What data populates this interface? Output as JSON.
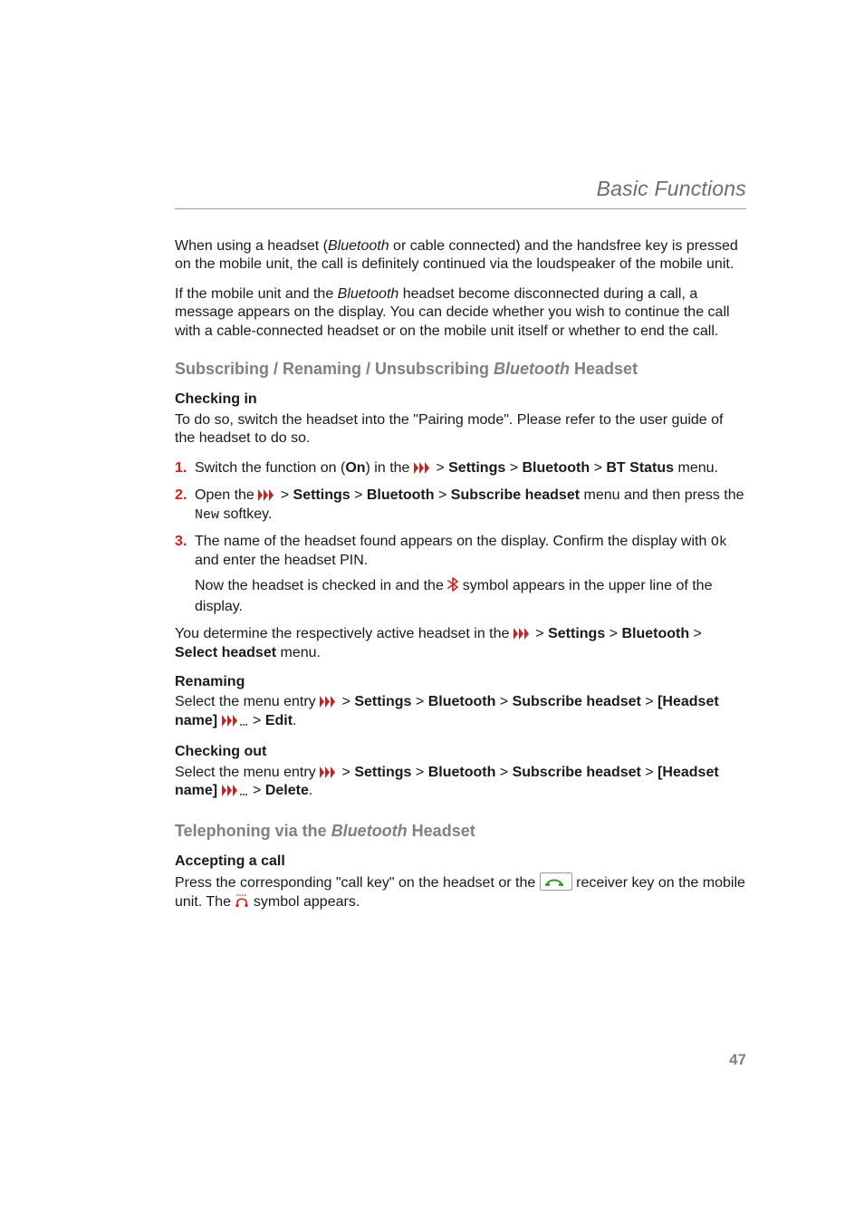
{
  "header": {
    "title": "Basic Functions"
  },
  "p1": {
    "a": "When using a headset (",
    "b": "Bluetooth",
    "c": " or cable connected) and the handsfree key is pressed on the mobile unit, the call is definitely continued via the loudspeaker of the mobile unit."
  },
  "p2": {
    "a": "If the mobile unit and the ",
    "b": "Bluetooth",
    "c": " headset become disconnected during a call, a message appears on the display. You can decide whether you wish to continue the call with a cable-connected headset or on the mobile unit itself or whether to end the call."
  },
  "h1": {
    "a": "Subscribing / Renaming / Unsubscribing ",
    "b": "Bluetooth",
    "c": " Headset"
  },
  "checkin": {
    "head": "Checking in",
    "intro": "To do so, switch the headset into the \"Pairing mode\". Please refer to the user guide of the headset to do so.",
    "s1": {
      "num": "1.",
      "a": "Switch the function on (",
      "b": "On",
      "c": ") in the ",
      "d": " > ",
      "e": "Settings",
      "f": " > ",
      "g": "Bluetooth",
      "h": " > ",
      "i": "BT Status",
      "j": " menu."
    },
    "s2": {
      "num": "2.",
      "a": "Open the ",
      "b": " > ",
      "c": "Settings",
      "d": " > ",
      "e": "Bluetooth",
      "f": " > ",
      "g": "Subscribe headset",
      "h": " menu and then press the ",
      "i": "New",
      "j": " softkey."
    },
    "s3": {
      "num": "3.",
      "a": "The name of the headset found appears on the display. Confirm the display with ",
      "b": "Ok",
      "c": " and enter the headset PIN.",
      "d": "Now the headset is checked in and the ",
      "e": " symbol appears in the upper line of the display."
    },
    "post": {
      "a": "You determine the respectively active headset in the ",
      "b": " > ",
      "c": "Settings",
      "d": " > ",
      "e": "Bluetooth",
      "f": " > ",
      "g": "Select headset",
      "h": " menu."
    }
  },
  "renaming": {
    "head": "Renaming",
    "a": "Select the menu entry ",
    "b": " > ",
    "c": "Settings",
    "d": " > ",
    "e": "Bluetooth",
    "f": " > ",
    "g": "Subscribe headset",
    "h": " > ",
    "i": "[Headset name] ",
    "j": " > ",
    "k": "Edit",
    "l": "."
  },
  "checkout": {
    "head": "Checking out",
    "a": "Select the menu entry ",
    "b": " > ",
    "c": "Settings",
    "d": " > ",
    "e": "Bluetooth",
    "f": " > ",
    "g": "Subscribe headset",
    "h": " > ",
    "i": "[Headset name] ",
    "j": " > ",
    "k": "Delete",
    "l": "."
  },
  "h2": {
    "a": "Telephoning via the ",
    "b": "Bluetooth",
    "c": " Headset"
  },
  "accept": {
    "head": "Accepting a call",
    "a": "Press the corresponding \"call key\" on the headset or the ",
    "b": " receiver key on the mobile unit. The ",
    "c": " symbol appears."
  },
  "pagenum": "47",
  "colors": {
    "accent": "#d11e1f",
    "muted": "#808080"
  }
}
